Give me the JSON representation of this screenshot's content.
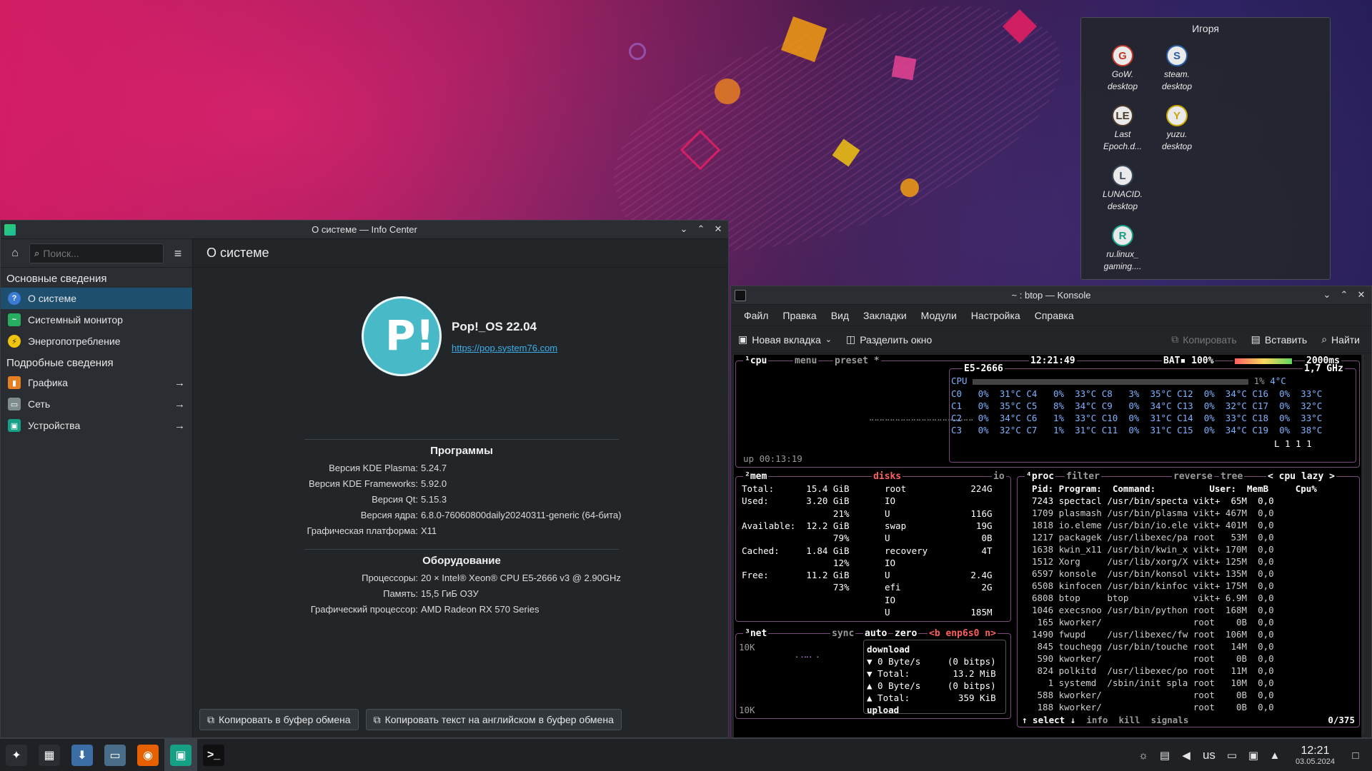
{
  "folder": {
    "title": "Игоря",
    "items": [
      {
        "label": "GoW.\ndesktop",
        "icon": "gow-icon",
        "glyph": "G",
        "color": "#c0392b"
      },
      {
        "label": "steam.\ndesktop",
        "icon": "steam-icon",
        "glyph": "S",
        "color": "#2a5fa8"
      },
      {
        "label": "Last\nEpoch.d...",
        "icon": "last-epoch-icon",
        "glyph": "LE",
        "color": "#4b3b2a"
      },
      {
        "label": "yuzu.\ndesktop",
        "icon": "yuzu-icon",
        "glyph": "Y",
        "color": "#c7a800"
      },
      {
        "label": "LUNACID.\ndesktop",
        "icon": "lunacid-icon",
        "glyph": "L",
        "color": "#3b4a5a"
      },
      {
        "label": "",
        "icon": "",
        "glyph": "",
        "color": ""
      },
      {
        "label": "ru.linux_\ngaming....",
        "icon": "linux-gaming-icon",
        "glyph": "R",
        "color": "#16a085"
      }
    ]
  },
  "info": {
    "window_title": "О системе — Info Center",
    "search_placeholder": "Поиск...",
    "sections": {
      "basic": "Основные сведения",
      "detailed": "Подробные сведения"
    },
    "nav": [
      {
        "label": "О системе",
        "color": "#3a7bd5",
        "glyph": "?"
      },
      {
        "label": "Системный монитор",
        "color": "#27ae60",
        "glyph": "~"
      },
      {
        "label": "Энергопотребление",
        "color": "#f1c40f",
        "glyph": "⚡"
      },
      {
        "label": "Графика",
        "color": "#e67e22",
        "glyph": "▮"
      },
      {
        "label": "Сеть",
        "color": "#7f8c8d",
        "glyph": "▭"
      },
      {
        "label": "Устройства",
        "color": "#16a085",
        "glyph": "▣"
      }
    ],
    "page_title": "О системе",
    "distro_name": "Pop!_OS 22.04",
    "distro_url": "https://pop.system76.com",
    "software_title": "Программы",
    "software": [
      {
        "k": "Версия KDE Plasma:",
        "v": "5.24.7"
      },
      {
        "k": "Версия KDE Frameworks:",
        "v": "5.92.0"
      },
      {
        "k": "Версия Qt:",
        "v": "5.15.3"
      },
      {
        "k": "Версия ядра:",
        "v": "6.8.0-76060800daily20240311-generic (64-бита)"
      },
      {
        "k": "Графическая платформа:",
        "v": "X11"
      }
    ],
    "hardware_title": "Оборудование",
    "hardware": [
      {
        "k": "Процессоры:",
        "v": "20 × Intel® Xeon® CPU E5-2666 v3 @ 2.90GHz"
      },
      {
        "k": "Память:",
        "v": "15,5 ГиБ ОЗУ"
      },
      {
        "k": "Графический процессор:",
        "v": "AMD Radeon RX 570 Series"
      }
    ],
    "copy_btn": "Копировать в буфер обмена",
    "copy_en_btn": "Копировать текст на английском в буфер обмена"
  },
  "konsole": {
    "window_title": "~ : btop — Konsole",
    "menu": [
      "Файл",
      "Правка",
      "Вид",
      "Закладки",
      "Модули",
      "Настройка",
      "Справка"
    ],
    "new_tab": "Новая вкладка",
    "split": "Разделить окно",
    "copy": "Копировать",
    "paste": "Вставить",
    "find": "Найти"
  },
  "btop": {
    "header": {
      "cpu": "¹cpu",
      "menu": "menu",
      "preset": "preset *",
      "time": "12:21:49",
      "bat": "BAT▪ 100%",
      "interval": "2000ms",
      "cpu_model": "E5-2666",
      "freq": "1,7 GHz",
      "cpu_total": "CPU",
      "cpu_pct": "1%",
      "cpu_temp": "4°C",
      "uptime": "up 00:13:19",
      "load": "L 1 1 1"
    },
    "cores": [
      "C0   0%  31°C C4   0%  33°C C8   3%  35°C C12  0%  34°C C16  0%  33°C",
      "C1   0%  35°C C5   8%  34°C C9   0%  34°C C13  0%  32°C C17  0%  32°C",
      "C2   0%  34°C C6   1%  33°C C10  0%  31°C C14  0%  33°C C18  0%  33°C",
      "C3   0%  32°C C7   1%  31°C C11  0%  31°C C15  0%  34°C C19  0%  38°C"
    ],
    "mem": [
      "Total:      15.4 GiB",
      "Used:       3.20 GiB",
      "                 21%",
      "Available:  12.2 GiB",
      "                 79%",
      "Cached:     1.84 GiB",
      "                 12%",
      "Free:       11.2 GiB",
      "                 73%"
    ],
    "disks": [
      "root            224G",
      "IO",
      "U               116G",
      "swap             19G",
      "U                 0B",
      "recovery          4T",
      "IO",
      "U               2.4G",
      "efi               2G",
      "IO",
      "U               185M"
    ],
    "net": {
      "label": "³net",
      "sync": "sync",
      "auto": "auto",
      "zero": "zero",
      "iface": "<b enp6s0 n>",
      "scale_top": "10K",
      "scale_bottom": "10K",
      "lines": [
        "download",
        "▼ 0 Byte/s     (0 bitps)",
        "▼ Total:        13.2 MiB",
        "▲ 0 Byte/s     (0 bitps)",
        "▲ Total:         359 KiB",
        "upload"
      ]
    },
    "proc_header": "Pid: Program:  Command:          User:  MemB     Cpu%",
    "proc": [
      "7243 spectacl /usr/bin/specta vikt+  65M  0,0",
      "1709 plasmash /usr/bin/plasma vikt+ 467M  0,0",
      "1818 io.eleme /usr/bin/io.ele vikt+ 401M  0,0",
      "1217 packagek /usr/libexec/pa root   53M  0,0",
      "1638 kwin_x11 /usr/bin/kwin_x vikt+ 170M  0,0",
      "1512 Xorg     /usr/lib/xorg/X vikt+ 125M  0,0",
      "6597 konsole  /usr/bin/konsol vikt+ 135M  0,0",
      "6508 kinfocen /usr/bin/kinfoc vikt+ 175M  0,0",
      "6808 btop     btop            vikt+ 6.9M  0,0",
      "1046 execsnoo /usr/bin/python root  168M  0,0",
      " 165 kworker/                 root    0B  0,0",
      "1490 fwupd    /usr/libexec/fw root  106M  0,0",
      " 845 touchegg /usr/bin/touche root   14M  0,0",
      " 590 kworker/                 root    0B  0,0",
      " 824 polkitd  /usr/libexec/po root   11M  0,0",
      "   1 systemd  /sbin/init spla root   10M  0,0",
      " 588 kworker/                 root    0B  0,0",
      " 188 kworker/                 root    0B  0,0"
    ],
    "proc_labels": {
      "proc": "⁴proc",
      "filter": "filter",
      "reverse": "reverse",
      "tree": "tree",
      "mode": "< cpu lazy >"
    },
    "proc_footer": {
      "select": "↑ select ↓",
      "info": "info",
      "kill": "kill",
      "signals": "signals",
      "count": "0/375"
    }
  },
  "taskbar": {
    "apps": [
      {
        "name": "launcher-button",
        "glyph": "✦",
        "color": "#2a2e32"
      },
      {
        "name": "pager-button",
        "glyph": "▦",
        "color": "#2a2e32"
      },
      {
        "name": "discover-button",
        "glyph": "⬇",
        "color": "#3a6ea5"
      },
      {
        "name": "files-button",
        "glyph": "▭",
        "color": "#4a6e8a"
      },
      {
        "name": "firefox-button",
        "glyph": "◉",
        "color": "#e66000"
      },
      {
        "name": "infocenter-button",
        "glyph": "▣",
        "color": "#16a085"
      },
      {
        "name": "konsole-button",
        "glyph": ">_",
        "color": "#101010"
      }
    ],
    "lang": "us",
    "time": "12:21",
    "date": "03.05.2024"
  }
}
